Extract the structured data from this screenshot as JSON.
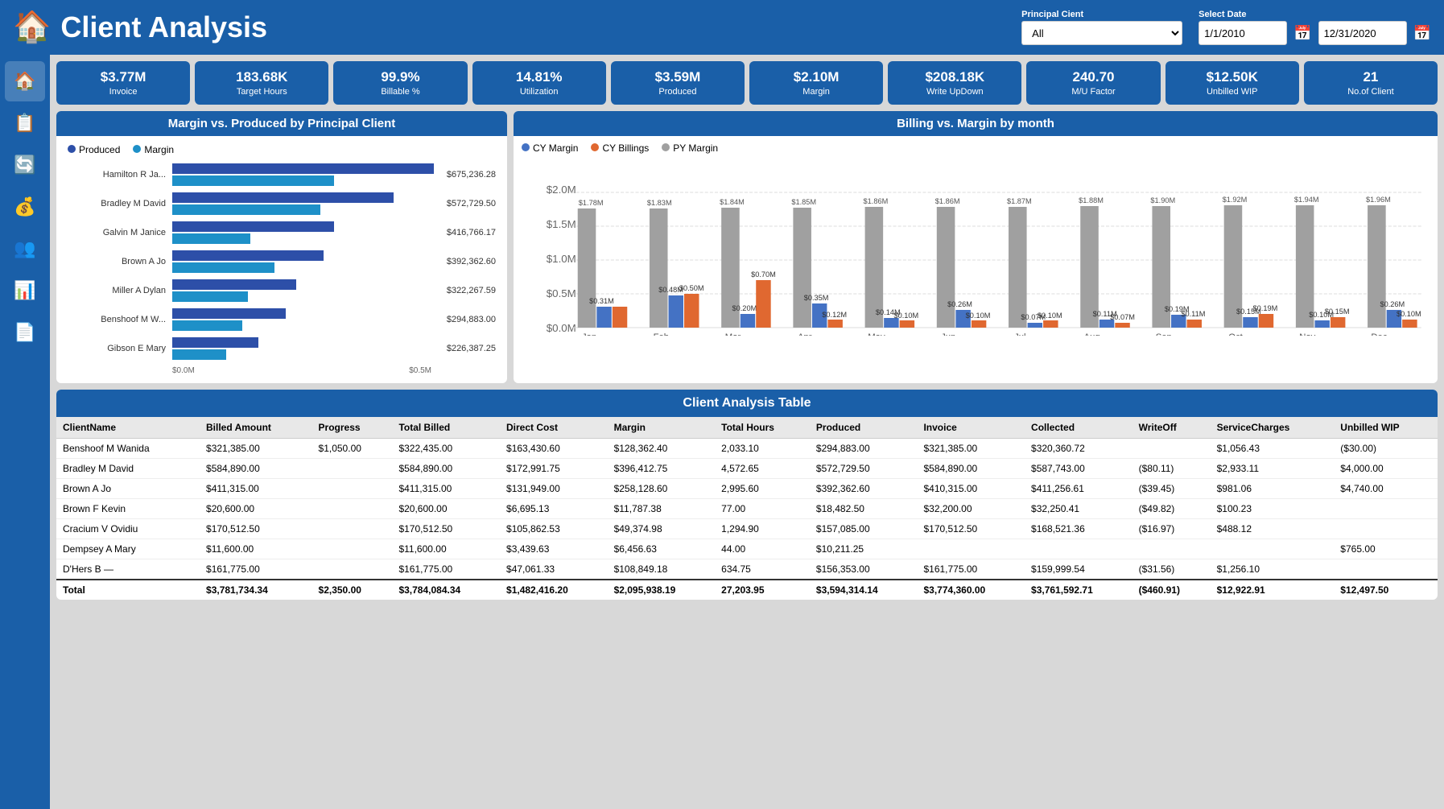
{
  "header": {
    "title": "Client Analysis",
    "principal_client_label": "Principal Cient",
    "principal_client_value": "All",
    "select_date_label": "Select Date",
    "date_from": "1/1/2010",
    "date_to": "12/31/2020"
  },
  "kpis": [
    {
      "value": "$3.77M",
      "label": "Invoice"
    },
    {
      "value": "183.68K",
      "label": "Target Hours"
    },
    {
      "value": "99.9%",
      "label": "Billable %"
    },
    {
      "value": "14.81%",
      "label": "Utilization"
    },
    {
      "value": "$3.59M",
      "label": "Produced"
    },
    {
      "value": "$2.10M",
      "label": "Margin"
    },
    {
      "value": "$208.18K",
      "label": "Write UpDown"
    },
    {
      "value": "240.70",
      "label": "M/U Factor"
    },
    {
      "value": "$12.50K",
      "label": "Unbilled WIP"
    },
    {
      "value": "21",
      "label": "No.of Client"
    }
  ],
  "margin_chart": {
    "title": "Margin vs. Produced by Principal Client",
    "legend": [
      {
        "label": "Produced",
        "color": "#2d4fa8"
      },
      {
        "label": "Margin",
        "color": "#1e90c8"
      }
    ],
    "bars": [
      {
        "name": "Hamilton R Ja...",
        "produced": 675236.28,
        "margin": 400000,
        "value": "$675,236.28"
      },
      {
        "name": "Bradley M David",
        "produced": 572729.5,
        "margin": 380000,
        "value": "$572,729.50"
      },
      {
        "name": "Galvin M Janice",
        "produced": 416766.17,
        "margin": 200148.67,
        "value": "$416,766.17"
      },
      {
        "name": "Brown A Jo",
        "produced": 392362.6,
        "margin": 260000,
        "value": "$392,362.60"
      },
      {
        "name": "Miller A Dylan",
        "produced": 322267.59,
        "margin": 200000,
        "value": "$322,267.59"
      },
      {
        "name": "Benshoof M W...",
        "produced": 294883.0,
        "margin": 190000,
        "value": "$294,883.00"
      },
      {
        "name": "Gibson E Mary",
        "produced": 226387.25,
        "margin": 150000,
        "value": "$226,387.25"
      }
    ],
    "x_labels": [
      "$0.0M",
      "$0.5M"
    ],
    "max": 700000
  },
  "billing_chart": {
    "title": "Billing vs. Margin by month",
    "legend": [
      {
        "label": "CY Margin",
        "color": "#4472c4"
      },
      {
        "label": "CY Billings",
        "color": "#e06830"
      },
      {
        "label": "PY Margin",
        "color": "#a0a0a0"
      }
    ],
    "months": [
      "Jan",
      "Feb",
      "Mar",
      "Apr",
      "May",
      "Jun",
      "Jul",
      "Aug",
      "Sep",
      "Oct",
      "Nov",
      "Dec"
    ],
    "cy_margin": [
      0.31,
      0.48,
      0.2,
      0.12,
      0.14,
      0.1,
      0.07,
      0.11,
      0.19,
      0.15,
      0.1,
      0.26
    ],
    "cy_billings": [
      0.31,
      0.5,
      0.7,
      0.35,
      0.1,
      0.26,
      0.1,
      0.07,
      0.11,
      0.19,
      0.15,
      0.1
    ],
    "py_margin": [
      1.78,
      1.83,
      1.84,
      1.85,
      1.86,
      1.86,
      1.87,
      1.88,
      1.9,
      1.92,
      1.94,
      1.96
    ],
    "y_labels": [
      "$0.0M",
      "$0.5M",
      "$1.0M",
      "$1.5M",
      "$2.0M"
    ]
  },
  "table": {
    "title": "Client Analysis Table",
    "columns": [
      "ClientName",
      "Billed Amount",
      "Progress",
      "Total Billed",
      "Direct Cost",
      "Margin",
      "Total Hours",
      "Produced",
      "Invoice",
      "Collected",
      "WriteOff",
      "ServiceCharges",
      "Unbilled WIP"
    ],
    "rows": [
      [
        "Benshoof M Wanida",
        "$321,385.00",
        "$1,050.00",
        "$322,435.00",
        "$163,430.60",
        "$128,362.40",
        "2,033.10",
        "$294,883.00",
        "$321,385.00",
        "$320,360.72",
        "",
        "$1,056.43",
        "($30.00)"
      ],
      [
        "Bradley M David",
        "$584,890.00",
        "",
        "$584,890.00",
        "$172,991.75",
        "$396,412.75",
        "4,572.65",
        "$572,729.50",
        "$584,890.00",
        "$587,743.00",
        "($80.11)",
        "$2,933.11",
        "$4,000.00"
      ],
      [
        "Brown A Jo",
        "$411,315.00",
        "",
        "$411,315.00",
        "$131,949.00",
        "$258,128.60",
        "2,995.60",
        "$392,362.60",
        "$410,315.00",
        "$411,256.61",
        "($39.45)",
        "$981.06",
        "$4,740.00"
      ],
      [
        "Brown F Kevin",
        "$20,600.00",
        "",
        "$20,600.00",
        "$6,695.13",
        "$11,787.38",
        "77.00",
        "$18,482.50",
        "$32,200.00",
        "$32,250.41",
        "($49.82)",
        "$100.23",
        ""
      ],
      [
        "Cracium V Ovidiu",
        "$170,512.50",
        "",
        "$170,512.50",
        "$105,862.53",
        "$49,374.98",
        "1,294.90",
        "$157,085.00",
        "$170,512.50",
        "$168,521.36",
        "($16.97)",
        "$488.12",
        ""
      ],
      [
        "Dempsey A Mary",
        "$11,600.00",
        "",
        "$11,600.00",
        "$3,439.63",
        "$6,456.63",
        "44.00",
        "$10,211.25",
        "",
        "",
        "",
        "",
        "$765.00"
      ],
      [
        "D'Hers B —",
        "$161,775.00",
        "",
        "$161,775.00",
        "$47,061.33",
        "$108,849.18",
        "634.75",
        "$156,353.00",
        "$161,775.00",
        "$159,999.54",
        "($31.56)",
        "$1,256.10",
        ""
      ]
    ],
    "totals": [
      "Total",
      "$3,781,734.34",
      "$2,350.00",
      "$3,784,084.34",
      "$1,482,416.20",
      "$2,095,938.19",
      "27,203.95",
      "$3,594,314.14",
      "$3,774,360.00",
      "$3,761,592.71",
      "($460.91)",
      "$12,922.91",
      "$12,497.50"
    ]
  },
  "sidebar": {
    "items": [
      {
        "icon": "🏠",
        "name": "home"
      },
      {
        "icon": "📋",
        "name": "reports"
      },
      {
        "icon": "🔄",
        "name": "refresh"
      },
      {
        "icon": "💰",
        "name": "finance"
      },
      {
        "icon": "👥",
        "name": "clients"
      },
      {
        "icon": "📊",
        "name": "analytics"
      },
      {
        "icon": "📄",
        "name": "documents"
      }
    ]
  }
}
